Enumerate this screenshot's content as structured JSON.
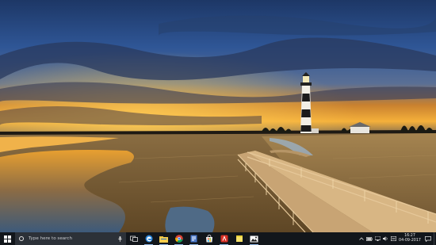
{
  "taskbar": {
    "search_placeholder": "Type here to search",
    "pinned_apps": [
      {
        "name": "task-view-icon"
      },
      {
        "name": "edge-browser-icon"
      },
      {
        "name": "file-explorer-icon"
      },
      {
        "name": "chrome-icon"
      },
      {
        "name": "document-viewer-icon"
      },
      {
        "name": "store-icon"
      },
      {
        "name": "red-app-icon"
      },
      {
        "name": "sticky-notes-icon"
      },
      {
        "name": "photos-icon"
      }
    ],
    "tray_icons": [
      "chevron-up-icon",
      "battery-icon",
      "network-icon",
      "volume-icon",
      "language-icon"
    ],
    "time": "16:27",
    "date": "04-09-2017"
  },
  "colors": {
    "taskbar_bg": "#12161b",
    "search_bg": "#2c3138",
    "accent": "#8fb3e0"
  }
}
